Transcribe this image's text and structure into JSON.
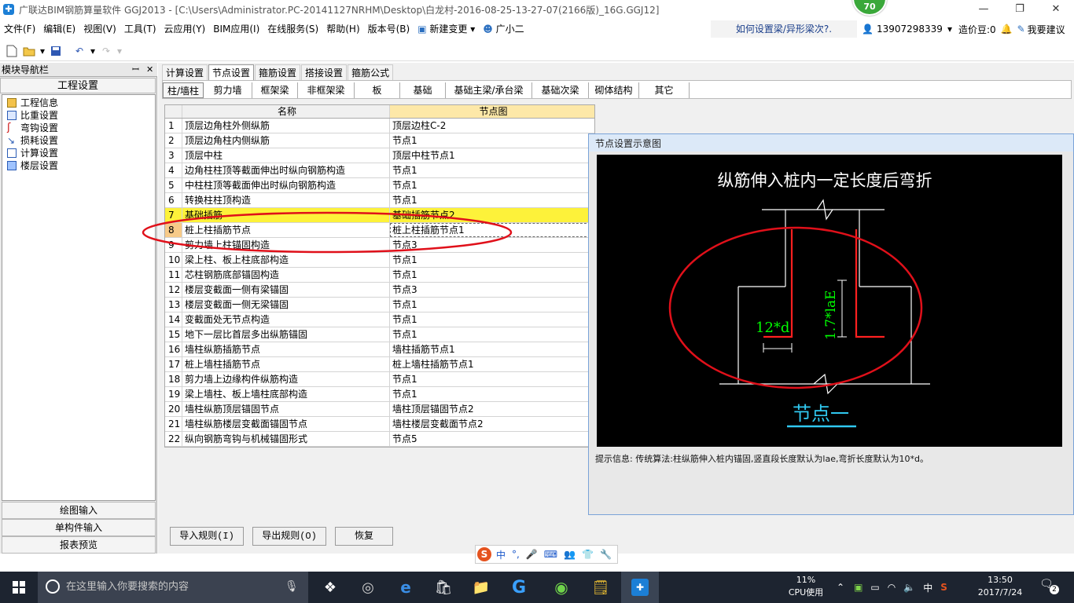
{
  "window": {
    "title": "广联达BIM钢筋算量软件 GGJ2013 - [C:\\Users\\Administrator.PC-20141127NRHM\\Desktop\\白龙村-2016-08-25-13-27-07(2166版)_16G.GGJ12]",
    "score_badge": "70",
    "min": "—",
    "max": "❐",
    "close": "✕"
  },
  "menu": {
    "items": [
      "文件(F)",
      "编辑(E)",
      "视图(V)",
      "工具(T)",
      "云应用(Y)",
      "BIM应用(I)",
      "在线服务(S)",
      "帮助(H)",
      "版本号(B)"
    ],
    "new_change": "新建变更",
    "guang_xiaoer": "广小二",
    "help_question": "如何设置梁/异形梁次?.",
    "phone": "13907298339",
    "price_bean": "造价豆:0",
    "suggest": "我要建议"
  },
  "nav": {
    "title": "模块导航栏",
    "pin": "ꟷ",
    "close": "✕",
    "section": "工程设置",
    "tree": [
      "工程信息",
      "比重设置",
      "弯钩设置",
      "损耗设置",
      "计算设置",
      "楼层设置"
    ],
    "buttons": [
      "绘图输入",
      "单构件输入",
      "报表预览"
    ]
  },
  "tabs_top": [
    "计算设置",
    "节点设置",
    "箍筋设置",
    "搭接设置",
    "箍筋公式"
  ],
  "tabs_sub": [
    "柱/墙柱",
    "剪力墙",
    "框架梁",
    "非框架梁",
    "板",
    "基础",
    "基础主梁/承台梁",
    "基础次梁",
    "砌体结构",
    "其它"
  ],
  "grid": {
    "col_name": "名称",
    "col_node": "节点图",
    "rows": [
      {
        "n": "1",
        "name": "顶层边角柱外侧纵筋",
        "node": "顶层边柱C-2"
      },
      {
        "n": "2",
        "name": "顶层边角柱内侧纵筋",
        "node": "节点1"
      },
      {
        "n": "3",
        "name": "顶层中柱",
        "node": "顶层中柱节点1"
      },
      {
        "n": "4",
        "name": "边角柱柱顶等截面伸出时纵向钢筋构造",
        "node": "节点1"
      },
      {
        "n": "5",
        "name": "中柱柱顶等截面伸出时纵向钢筋构造",
        "node": "节点1"
      },
      {
        "n": "6",
        "name": "转换柱柱顶构造",
        "node": "节点1"
      },
      {
        "n": "7",
        "name": "基础插筋",
        "node": "基础插筋节点2"
      },
      {
        "n": "8",
        "name": "桩上柱插筋节点",
        "node": "桩上柱插筋节点1"
      },
      {
        "n": "9",
        "name": "剪力墙上柱锚固构造",
        "node": "节点3"
      },
      {
        "n": "10",
        "name": "梁上柱、板上柱底部构造",
        "node": "节点1"
      },
      {
        "n": "11",
        "name": "芯柱钢筋底部锚固构造",
        "node": "节点1"
      },
      {
        "n": "12",
        "name": "楼层变截面一侧有梁锚固",
        "node": "节点3"
      },
      {
        "n": "13",
        "name": "楼层变截面一侧无梁锚固",
        "node": "节点1"
      },
      {
        "n": "14",
        "name": "变截面处无节点构造",
        "node": "节点1"
      },
      {
        "n": "15",
        "name": "地下一层比首层多出纵筋锚固",
        "node": "节点1"
      },
      {
        "n": "16",
        "name": "墙柱纵筋插筋节点",
        "node": "墙柱插筋节点1"
      },
      {
        "n": "17",
        "name": "桩上墙柱插筋节点",
        "node": "桩上墙柱插筋节点1"
      },
      {
        "n": "18",
        "name": "剪力墙上边缘构件纵筋构造",
        "node": "节点1"
      },
      {
        "n": "19",
        "name": "梁上墙柱、板上墙柱底部构造",
        "node": "节点1"
      },
      {
        "n": "20",
        "name": "墙柱纵筋顶层锚固节点",
        "node": "墙柱顶层锚固节点2"
      },
      {
        "n": "21",
        "name": "墙柱纵筋楼层变截面锚固节点",
        "node": "墙柱楼层变截面节点2"
      },
      {
        "n": "22",
        "name": "纵向钢筋弯钩与机械锚固形式",
        "node": "节点5"
      }
    ]
  },
  "preview": {
    "title": "节点设置示意图",
    "heading": "纵筋伸入桩内一定长度后弯折",
    "dim_bend": "12*d",
    "dim_vertical": "1.7*laE",
    "node_label": "节点一",
    "hint": "提示信息: 传统算法:柱纵筋伸入桩内锚固,竖直段长度默认为lae,弯折长度默认为10*d。"
  },
  "buttons": {
    "import": "导入规则(I)",
    "export": "导出规则(O)",
    "restore": "恢复"
  },
  "ime": {
    "mode": "中"
  },
  "taskbar": {
    "search_placeholder": "在这里输入你要搜索的内容",
    "cpu_percent": "11%",
    "cpu_label": "CPU使用",
    "ime": "中",
    "time": "13:50",
    "date": "2017/7/24",
    "notify": "2"
  },
  "colors": {
    "selected_row": "#fdf23a",
    "annotation_red": "#e0101a",
    "rebar_red": "#ff2020",
    "dim_green": "#00ff00",
    "label_cyan": "#30c8f0"
  }
}
